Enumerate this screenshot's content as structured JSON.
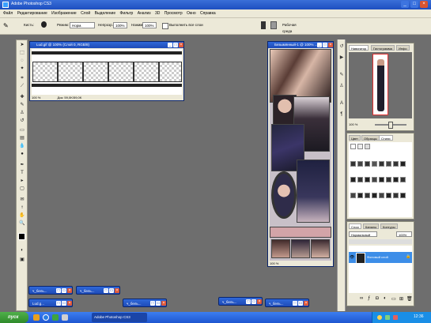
{
  "app": {
    "title": "Adobe Photoshop CS3"
  },
  "menu": [
    "Файл",
    "Редактирование",
    "Изображение",
    "Слой",
    "Выделение",
    "Фильтр",
    "Анализ",
    "3D",
    "Просмотр",
    "Окно",
    "Справка"
  ],
  "options": {
    "brush_label": "Кисть:",
    "mode_label": "Режим:",
    "mode_value": "Норм.",
    "opacity_label": "Непрозр.:",
    "opacity_value": "100%",
    "flow_label": "Нажим:",
    "flow_value": "100%",
    "sample_label": "Выполнить все слои",
    "workspace_label": "Рабочая среда"
  },
  "doc1": {
    "title": "Lud.gif @ 100% (Слой 0, RGB/8)",
    "zoom": "100 %",
    "status": "Док: 59,0K/59,0K"
  },
  "doc2": {
    "title": "Безымянный-1 @ 100% ...",
    "zoom": "100 %"
  },
  "navigator": {
    "tabs": [
      "Навигатор",
      "Гистограмма",
      "Инфо"
    ],
    "zoom": "100 %"
  },
  "styles_panel": {
    "tabs": [
      "Цвет",
      "Образцы",
      "Стили"
    ]
  },
  "layers_panel": {
    "tabs": [
      "Слои",
      "Каналы",
      "Контуры"
    ],
    "blend": "Нормальный",
    "opacity": "100%",
    "layer_name": "Фоновый слой"
  },
  "minimized": [
    "ч_бель...",
    "ч_бель...",
    "Lud.g...",
    "ч_бель...",
    "ч_бель...",
    "ч_бель..."
  ],
  "taskbar": {
    "start": "пуск",
    "task": "Adobe Photoshop CS3",
    "clock": "12:36"
  },
  "colors": {
    "xp_blue": "#1d4fc0",
    "panel": "#ece9d8",
    "workspace": "#6e6e6e"
  }
}
